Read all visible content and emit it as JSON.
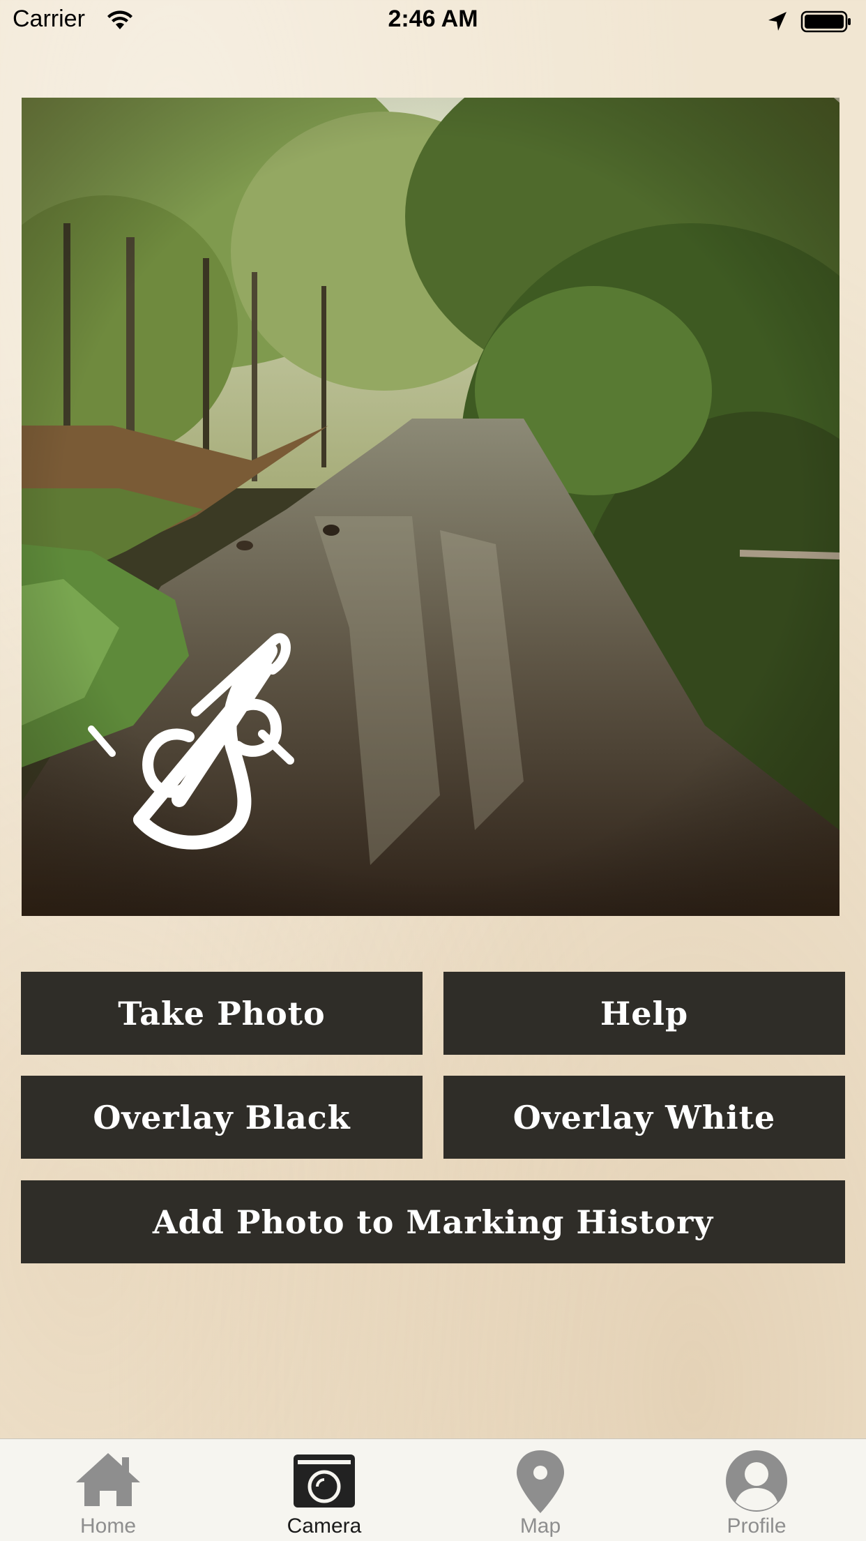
{
  "status_bar": {
    "carrier": "Carrier",
    "time": "2:46 AM",
    "wifi_icon": "wifi-icon",
    "location_icon": "location-arrow-icon",
    "battery_icon": "battery-icon"
  },
  "photo": {
    "overlay_icon": "sigil-mark-icon"
  },
  "buttons": {
    "take_photo": "Take Photo",
    "help": "Help",
    "overlay_black": "Overlay Black",
    "overlay_white": "Overlay White",
    "add_to_history": "Add Photo to Marking History"
  },
  "tab_bar": {
    "tabs": [
      {
        "label": "Home",
        "icon": "home-icon",
        "active": false
      },
      {
        "label": "Camera",
        "icon": "camera-icon",
        "active": true
      },
      {
        "label": "Map",
        "icon": "map-pin-icon",
        "active": false
      },
      {
        "label": "Profile",
        "icon": "profile-icon",
        "active": false
      }
    ]
  },
  "colors": {
    "button_bg": "#2f2d28",
    "button_text": "#ffffff",
    "background": "#f1e6d2",
    "tab_active": "#1a1a1a",
    "tab_inactive": "#8e8e8e"
  }
}
